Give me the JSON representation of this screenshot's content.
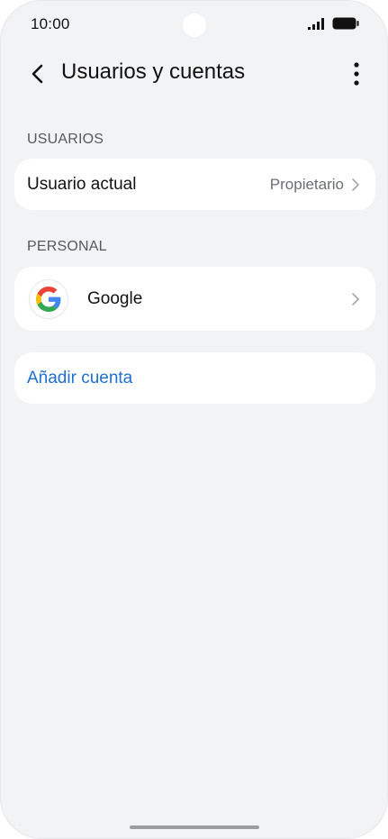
{
  "status_bar": {
    "time": "10:00"
  },
  "header": {
    "title": "Usuarios y cuentas",
    "back_icon": "chevron-left-icon",
    "menu_icon": "more-vertical-icon"
  },
  "sections": {
    "users_label": "USUARIOS",
    "personal_label": "PERSONAL"
  },
  "users_card": {
    "current_user_label": "Usuario actual",
    "current_user_value": "Propietario"
  },
  "personal_card": {
    "google_label": "Google",
    "google_icon": "google-logo-icon"
  },
  "add_account": {
    "label": "Añadir cuenta"
  },
  "colors": {
    "background": "#f2f3f5",
    "card": "#ffffff",
    "accent_link": "#1f6fd1",
    "secondary_text": "#6b6f75"
  }
}
